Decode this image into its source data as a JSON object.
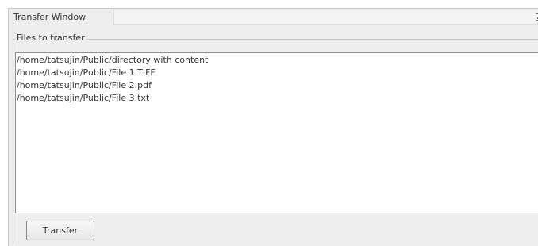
{
  "window": {
    "tab_title": "Transfer Window"
  },
  "files_panel": {
    "title": "Files to transfer",
    "items": [
      "/home/tatsujin/Public/directory with content",
      "/home/tatsujin/Public/File 1.TIFF",
      "/home/tatsujin/Public/File 2.pdf",
      "/home/tatsujin/Public/File 3.txt"
    ]
  },
  "actions": {
    "transfer_label": "Transfer"
  }
}
